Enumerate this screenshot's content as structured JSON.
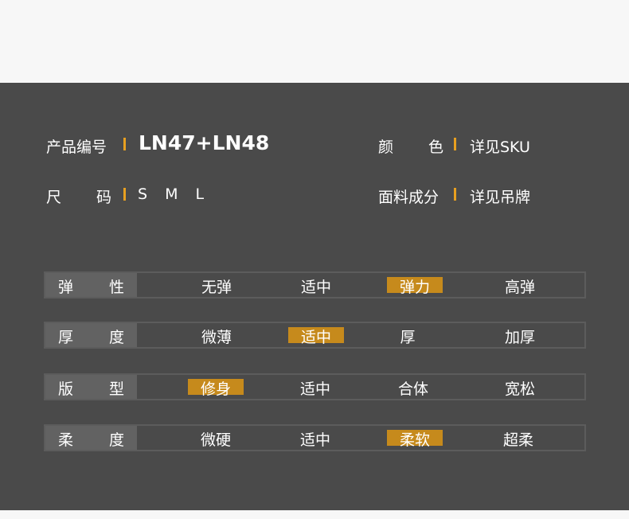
{
  "product": {
    "code_label": "产品编号",
    "code_value": "LN47+LN48",
    "size_label_1": "尺",
    "size_label_2": "码",
    "sizes": "S M L",
    "color_label_1": "颜",
    "color_label_2": "色",
    "color_value": "详见SKU",
    "material_label": "面料成分",
    "material_value": "详见吊牌"
  },
  "accent_color": "#e8a020",
  "highlight_color": "#c68a1c",
  "attributes": [
    {
      "label_1": "弹",
      "label_2": "性",
      "options": [
        "无弹",
        "适中",
        "弹力",
        "高弹"
      ],
      "selected": "弹力"
    },
    {
      "label_1": "厚",
      "label_2": "度",
      "options": [
        "微薄",
        "适中",
        "厚",
        "加厚"
      ],
      "selected": "适中"
    },
    {
      "label_1": "版",
      "label_2": "型",
      "options": [
        "修身",
        "适中",
        "合体",
        "宽松"
      ],
      "selected": "修身"
    },
    {
      "label_1": "柔",
      "label_2": "度",
      "options": [
        "微硬",
        "适中",
        "柔软",
        "超柔"
      ],
      "selected": "柔软"
    }
  ]
}
